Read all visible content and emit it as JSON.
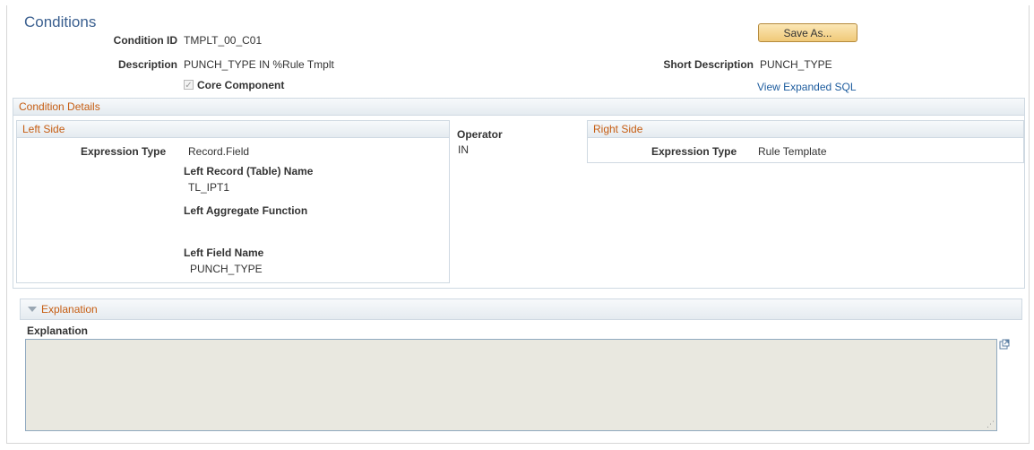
{
  "page": {
    "title": "Conditions",
    "condition_id_label": "Condition ID",
    "condition_id_value": "TMPLT_00_C01",
    "description_label": "Description",
    "description_value": "PUNCH_TYPE IN %Rule Tmplt",
    "short_description_label": "Short Description",
    "short_description_value": "PUNCH_TYPE",
    "core_component_label": "Core Component",
    "core_component_checked": true,
    "save_as_label": "Save As...",
    "view_sql_link": "View Expanded SQL"
  },
  "condition_details": {
    "header": "Condition Details",
    "left_side": {
      "header": "Left Side",
      "expression_type_label": "Expression Type",
      "expression_type_value": "Record.Field",
      "record_name_label": "Left Record (Table) Name",
      "record_name_value": "TL_IPT1",
      "aggregate_label": "Left Aggregate Function",
      "field_name_label": "Left Field Name",
      "field_name_value": "PUNCH_TYPE"
    },
    "operator": {
      "label": "Operator",
      "value": "IN"
    },
    "right_side": {
      "header": "Right Side",
      "expression_type_label": "Expression Type",
      "expression_type_value": "Rule Template"
    }
  },
  "explanation": {
    "header": "Explanation",
    "field_label": "Explanation",
    "value": ""
  },
  "colors": {
    "title": "#3a5f8f",
    "section_header": "#c65d12",
    "link": "#1d5c9e",
    "button": "#f0c978"
  },
  "icons": [
    "checkbox-checked-icon",
    "collapse-triangle-icon",
    "expand-window-icon",
    "resize-grip-icon"
  ]
}
